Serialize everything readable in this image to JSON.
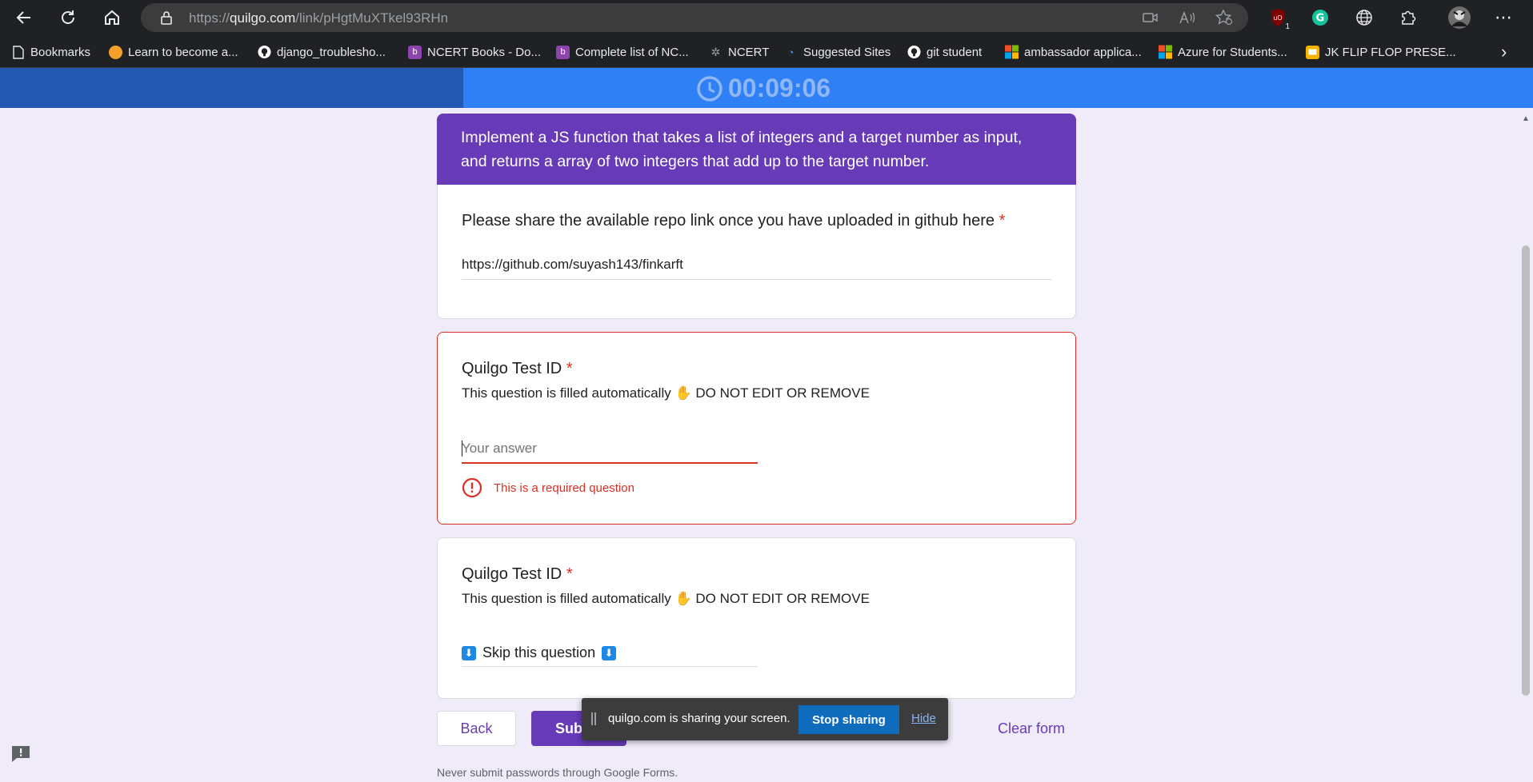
{
  "browser": {
    "url_prefix": "https://",
    "url_domain": "quilgo.com",
    "url_path": "/link/pHgtMuXTkel93RHn",
    "extension_badge": "1",
    "bookmarks": [
      {
        "label": "Bookmarks",
        "icon": "page-icon",
        "color": "#e8eaed"
      },
      {
        "label": "Learn to become a...",
        "icon": "mascot-icon",
        "color": "#f4a12a"
      },
      {
        "label": "django_troublesho...",
        "icon": "github-icon",
        "color": "#ffffff"
      },
      {
        "label": "NCERT Books - Do...",
        "icon": "brand-b-icon",
        "color": "#8e44ad"
      },
      {
        "label": "Complete list of NC...",
        "icon": "brand-b-icon",
        "color": "#8e44ad"
      },
      {
        "label": "NCERT",
        "icon": "ncert-icon",
        "color": "#9aa0a6"
      },
      {
        "label": "Suggested Sites",
        "icon": "suggested-icon",
        "color": "#4a90e2"
      },
      {
        "label": "git student",
        "icon": "github-icon",
        "color": "#ffffff"
      },
      {
        "label": "ambassador applica...",
        "icon": "microsoft-icon",
        "color": "#f25022"
      },
      {
        "label": "Azure for Students...",
        "icon": "microsoft-icon",
        "color": "#f25022"
      },
      {
        "label": "JK FLIP FLOP PRESE...",
        "icon": "slides-icon",
        "color": "#f4b400"
      }
    ]
  },
  "timer": {
    "value": "00:09:06"
  },
  "form": {
    "question_header": "Implement a JS function that takes a list of integers and a target number as input, and returns a array of two integers that add up to the target number.",
    "repo_question": {
      "title": "Please share the available repo link once you have uploaded in github here",
      "required_mark": "*",
      "value": "https://github.com/suyash143/finkarft"
    },
    "test_id_1": {
      "title": "Quilgo Test ID",
      "required_mark": "*",
      "desc_before": "This question is filled automatically",
      "hand_emoji": "✋",
      "desc_after": "DO NOT EDIT OR REMOVE",
      "placeholder": "Your answer",
      "error": "This is a required question"
    },
    "test_id_2": {
      "title": "Quilgo Test ID",
      "required_mark": "*",
      "desc_before": "This question is filled automatically",
      "hand_emoji": "✋",
      "desc_after": "DO NOT EDIT OR REMOVE",
      "arrow": "⬇",
      "value": "Skip this question"
    },
    "back_label": "Back",
    "submit_label": "Submit",
    "clear_label": "Clear form",
    "footer_note": "Never submit passwords through Google Forms."
  },
  "share_toast": {
    "message": "quilgo.com is sharing your screen.",
    "stop_label": "Stop sharing",
    "hide_label": "Hide"
  },
  "colors": {
    "accent": "#673ab7",
    "error": "#d93025",
    "timer_bg": "#2f7ff5"
  }
}
